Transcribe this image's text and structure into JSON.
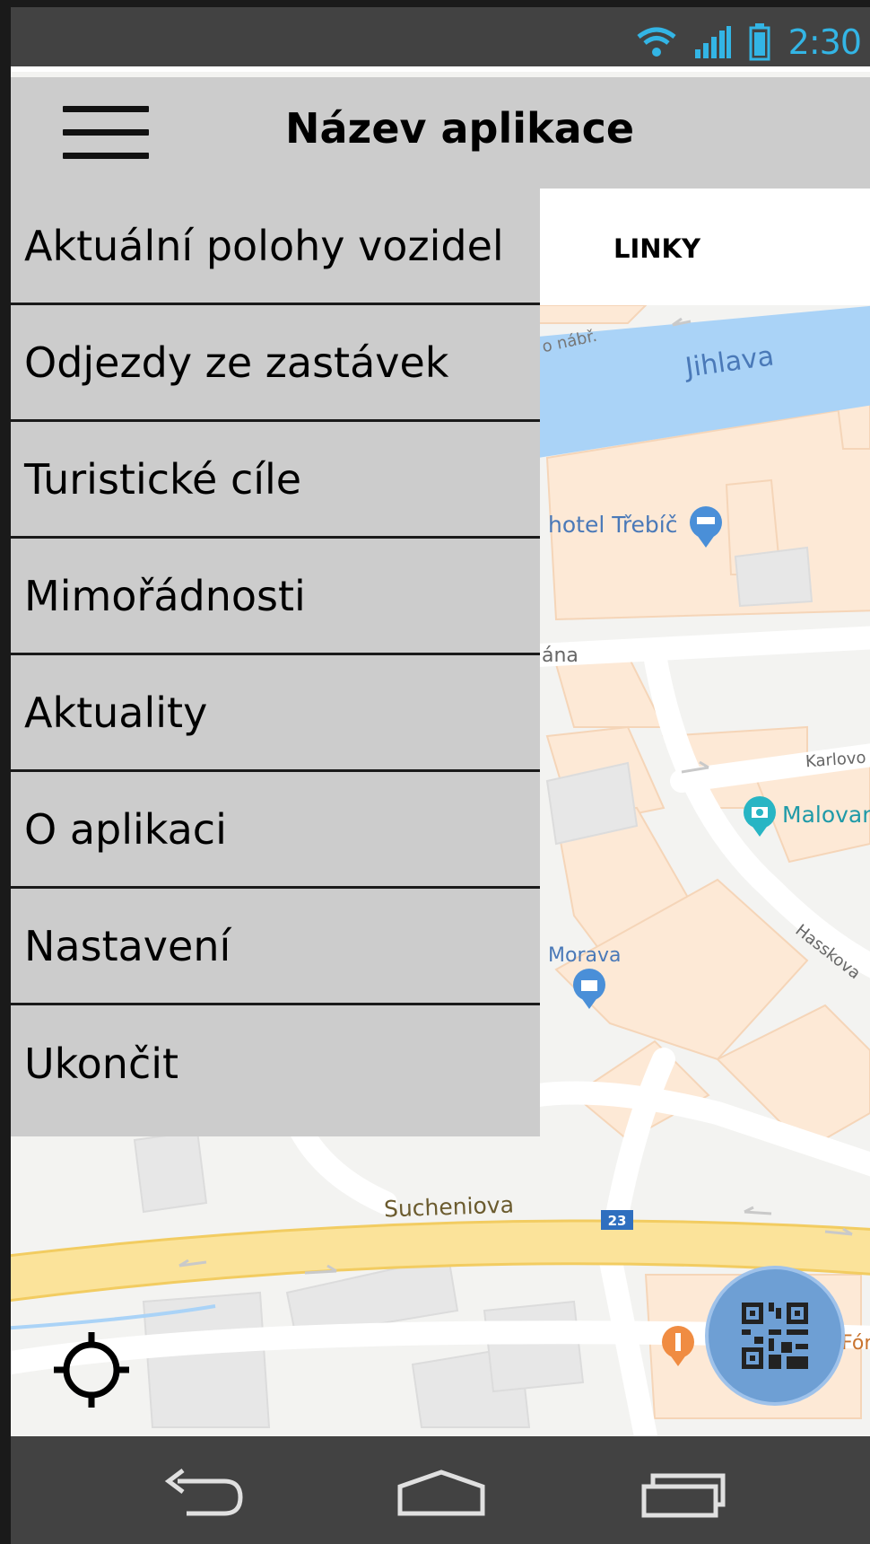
{
  "status_bar": {
    "time": "2:30",
    "icons": [
      "wifi-icon",
      "signal-icon",
      "battery-icon"
    ]
  },
  "app_bar": {
    "title": "Název aplikace",
    "menu_icon": "hamburger-icon"
  },
  "tabs": [
    {
      "label": "LINKY"
    }
  ],
  "drawer": {
    "items": [
      {
        "label": "Aktuální polohy vozidel"
      },
      {
        "label": "Odjezdy ze zastávek"
      },
      {
        "label": "Turistické cíle"
      },
      {
        "label": "Mimořádnosti"
      },
      {
        "label": "Aktuality"
      },
      {
        "label": "O aplikaci"
      },
      {
        "label": "Nastavení"
      },
      {
        "label": "Ukončit"
      }
    ]
  },
  "map": {
    "labels": {
      "river": "Jihlava",
      "embankment": "o nábř.",
      "hotel": "hotel Třebíč",
      "street_ana": "ána",
      "street_karlov": "Karlovo",
      "museum": "Malovan",
      "street_hasskova": "Hasskova",
      "shop": "Morava",
      "main_street": "Sucheniova",
      "road_number": "23",
      "restaurant": "Fór"
    },
    "colors": {
      "river": "#aad3f7",
      "main_road": "#fbe39a",
      "buildings": "#fde9d6",
      "poi_blue": "#4a8fd8",
      "poi_teal": "#28b5c4",
      "poi_orange": "#f08c42"
    }
  },
  "controls": {
    "locate_icon": "crosshair-icon",
    "qr_icon": "qr-code-icon"
  },
  "nav_bar": {
    "icons": [
      "back-icon",
      "home-icon",
      "recents-icon"
    ]
  },
  "colors": {
    "status_bar": "#424242",
    "status_accent": "#33b5e5",
    "app_bar": "#cccccc",
    "drawer": "#cccccc",
    "fab": "#6e9fd4"
  }
}
